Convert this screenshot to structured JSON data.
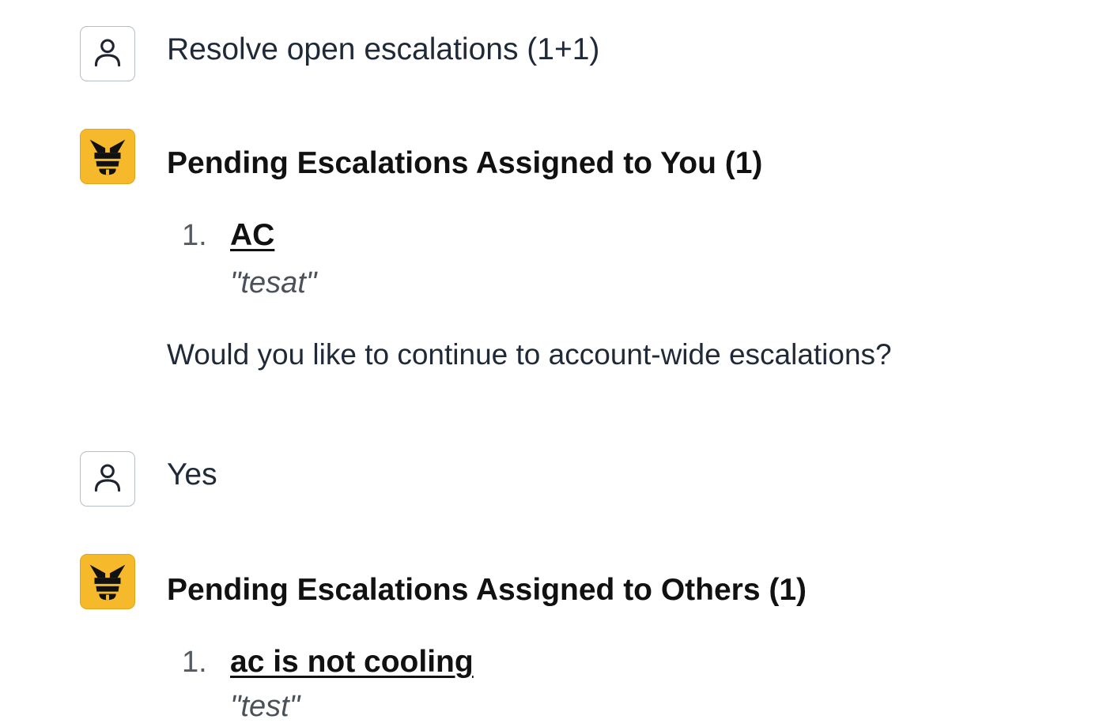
{
  "messages": {
    "user1": {
      "text": "Resolve open escalations (1+1)"
    },
    "bot1": {
      "heading": "Pending Escalations Assigned to You (1)",
      "items": [
        {
          "number": "1.",
          "title": "AC",
          "quote": "\"tesat\""
        }
      ],
      "followup": "Would you like to continue to account-wide escalations?"
    },
    "user2": {
      "text": "Yes"
    },
    "bot2": {
      "heading": "Pending Escalations Assigned to Others (1)",
      "items": [
        {
          "number": "1.",
          "title": "ac is not cooling",
          "quote": "\"test\""
        }
      ]
    }
  },
  "icons": {
    "user_avatar": "person-icon",
    "bot_avatar": "bee-logo-icon"
  },
  "colors": {
    "bot_avatar_bg": "#f6b92c",
    "user_avatar_border": "#b6bec9",
    "text": "#1f2937"
  }
}
